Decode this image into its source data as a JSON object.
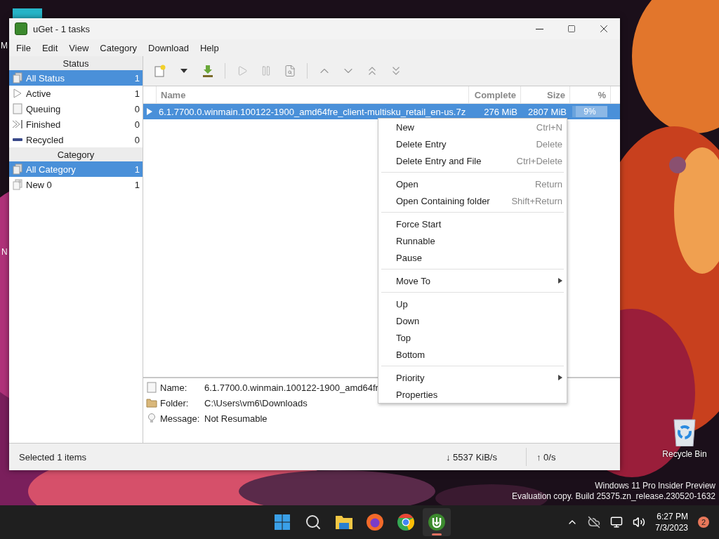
{
  "window": {
    "title": "uGet - 1 tasks"
  },
  "menu_bar": [
    "File",
    "Edit",
    "View",
    "Category",
    "Download",
    "Help"
  ],
  "sidebar": {
    "status_header": "Status",
    "category_header": "Category",
    "status_items": [
      {
        "kind": "all",
        "label": "All Status",
        "count": "1",
        "selected": true
      },
      {
        "kind": "active",
        "label": "Active",
        "count": "1",
        "selected": false
      },
      {
        "kind": "queuing",
        "label": "Queuing",
        "count": "0",
        "selected": false
      },
      {
        "kind": "finished",
        "label": "Finished",
        "count": "0",
        "selected": false
      },
      {
        "kind": "recycled",
        "label": "Recycled",
        "count": "0",
        "selected": false
      }
    ],
    "category_items": [
      {
        "kind": "all",
        "label": "All Category",
        "count": "1",
        "selected": true
      },
      {
        "kind": "category",
        "label": "New 0",
        "count": "1",
        "selected": false
      }
    ]
  },
  "table": {
    "columns": [
      "Name",
      "Complete",
      "Size",
      "%"
    ],
    "rows": [
      {
        "name": "6.1.7700.0.winmain.100122-1900_amd64fre_client-multisku_retail_en-us.7z",
        "complete": "276 MiB",
        "size": "2807 MiB",
        "percent": "9%",
        "level": 0.09,
        "selected": true
      }
    ]
  },
  "details": [
    {
      "kind": "file",
      "label": "Name:",
      "value": "6.1.7700.0.winmain.100122-1900_amd64fr"
    },
    {
      "kind": "folder",
      "label": "Folder:",
      "value": "C:\\Users\\vm6\\Downloads"
    },
    {
      "kind": "message",
      "label": "Message:",
      "value": "Not Resumable"
    }
  ],
  "status_bar": {
    "selection": "Selected 1 items",
    "download": "↓ 5537 KiB/s",
    "upload": "↑ 0/s"
  },
  "context_menu": [
    {
      "kind": "item",
      "label": "New",
      "shortcut": "Ctrl+N",
      "submenu": false
    },
    {
      "kind": "item",
      "label": "Delete Entry",
      "shortcut": "Delete",
      "submenu": false
    },
    {
      "kind": "item",
      "label": "Delete Entry and File",
      "shortcut": "Ctrl+Delete",
      "submenu": false
    },
    {
      "kind": "separator"
    },
    {
      "kind": "item",
      "label": "Open",
      "shortcut": "Return",
      "submenu": false
    },
    {
      "kind": "item",
      "label": "Open Containing folder",
      "shortcut": "Shift+Return",
      "submenu": false
    },
    {
      "kind": "separator"
    },
    {
      "kind": "item",
      "label": "Force Start",
      "submenu": false
    },
    {
      "kind": "item",
      "label": "Runnable",
      "submenu": false
    },
    {
      "kind": "item",
      "label": "Pause",
      "submenu": false
    },
    {
      "kind": "separator"
    },
    {
      "kind": "item",
      "label": "Move To",
      "submenu": true
    },
    {
      "kind": "separator"
    },
    {
      "kind": "item",
      "label": "Up",
      "submenu": false
    },
    {
      "kind": "item",
      "label": "Down",
      "submenu": false
    },
    {
      "kind": "item",
      "label": "Top",
      "submenu": false
    },
    {
      "kind": "item",
      "label": "Bottom",
      "submenu": false
    },
    {
      "kind": "separator"
    },
    {
      "kind": "item",
      "label": "Priority",
      "submenu": true
    },
    {
      "kind": "item",
      "label": "Properties",
      "submenu": false
    }
  ],
  "desktop": {
    "icon_labels": [
      "M",
      "N"
    ],
    "recycle_bin": "Recycle Bin",
    "watermark": [
      "Windows 11 Pro Insider Preview",
      "Evaluation copy. Build 25375.zn_release.230520-1632"
    ]
  },
  "taskbar": {
    "apps": [
      {
        "kind": "start",
        "selected": false
      },
      {
        "kind": "search",
        "selected": false
      },
      {
        "kind": "explorer",
        "selected": false
      },
      {
        "kind": "firefox",
        "selected": false
      },
      {
        "kind": "chrome",
        "selected": false
      },
      {
        "kind": "uget",
        "selected": true
      }
    ],
    "time": "6:27 PM",
    "date": "7/3/2023",
    "notifications": "2"
  }
}
